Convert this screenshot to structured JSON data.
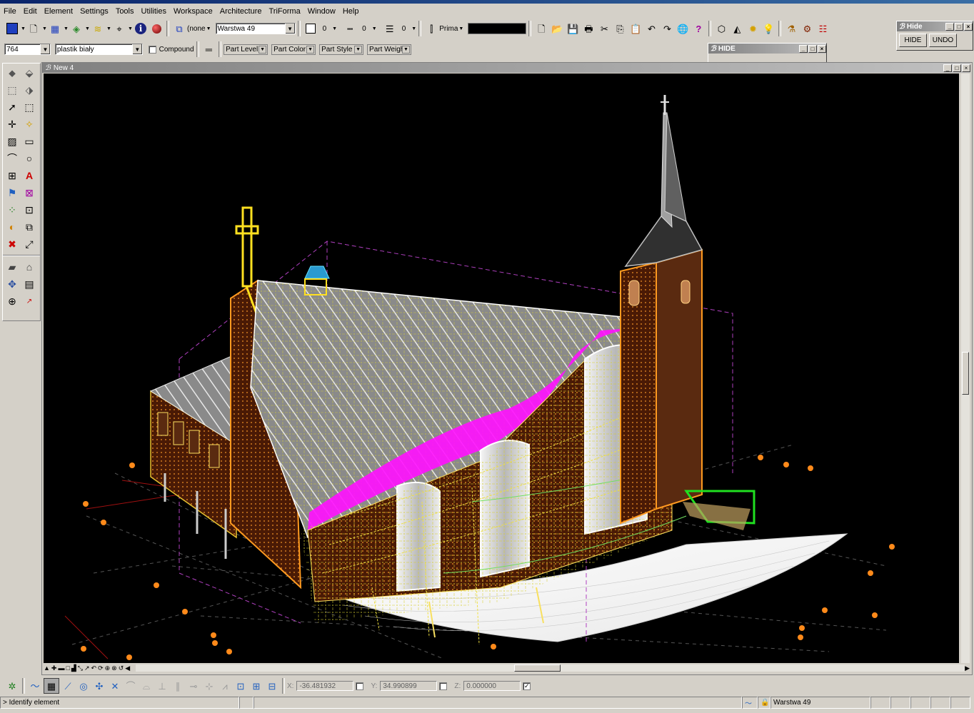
{
  "menu": [
    "File",
    "Edit",
    "Element",
    "Settings",
    "Tools",
    "Utilities",
    "Workspace",
    "Architecture",
    "TriForma",
    "Window",
    "Help"
  ],
  "toolbar1": {
    "active_style": "(none",
    "level_name": "Warstwa 49",
    "color_value": "0",
    "linestyle_value": "0",
    "weight_value": "0",
    "prim_label": "Prima"
  },
  "toolbar2": {
    "number_field": "764",
    "material_field": "plastik biały",
    "compound_label": "Compound",
    "part_level": "Part Level",
    "part_color": "Part Color",
    "part_style": "Part Style",
    "part_weight": "Part Weigh"
  },
  "hide_dialog_top": {
    "title": "Hide",
    "hide_button": "HIDE",
    "undo_button": "UNDO"
  },
  "hide_dialog_float": {
    "title": "HIDE"
  },
  "view_window": {
    "title": "New 4"
  },
  "coords": {
    "x_label": "X:",
    "x_value": "-36.481932",
    "y_label": "Y:",
    "y_value": "34.990899",
    "z_label": "Z:",
    "z_value": "0.000000"
  },
  "status": {
    "prompt": "> Identify element",
    "level": "Warstwa 49"
  },
  "icons": {
    "left_palette": [
      "place-element-icon",
      "place-solid-icon",
      "fence-icon",
      "modify-solid-icon",
      "select-arrow-icon",
      "selection-box-icon",
      "crosshair-icon",
      "point-light-icon",
      "hatch-icon",
      "rectangle-icon",
      "arc-icon",
      "circle-icon",
      "group-icon",
      "text-icon",
      "tag-icon",
      "dimension-icon",
      "snap-points-icon",
      "measure-icon",
      "palette-icon",
      "copy-icon",
      "delete-icon",
      "scale-icon",
      "wall-icon",
      "roof-icon",
      "move-icon",
      "report-icon",
      "compass-icon",
      "number-icon"
    ]
  }
}
